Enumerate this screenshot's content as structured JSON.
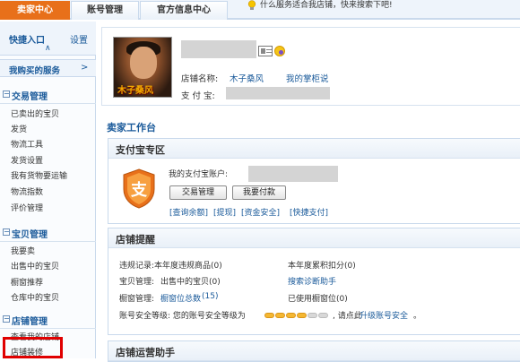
{
  "tabs": {
    "seller": "卖家中心",
    "account": "账号管理",
    "official": "官方信息中心"
  },
  "tip": "什么服务适合我店铺，快来搜索下吧!",
  "sidebar": {
    "quick_entry": "快捷入口",
    "settings": "设置",
    "bought_services": "我购买的服务",
    "sections": [
      {
        "title": "交易管理",
        "items": [
          "已卖出的宝贝",
          "发货",
          "物流工具",
          "发货设置",
          "我有货物要运输",
          "物流指数",
          "评价管理"
        ]
      },
      {
        "title": "宝贝管理",
        "items": [
          "我要卖",
          "出售中的宝贝",
          "橱窗推荐",
          "仓库中的宝贝"
        ]
      },
      {
        "title": "店铺管理",
        "items": [
          "查看我的店铺",
          "店铺装修"
        ]
      }
    ]
  },
  "profile": {
    "shop_name_label": "店铺名称:",
    "shop_name": "木子桑风",
    "my_counter": "我的掌柜说",
    "alipay_label": "支 付 宝:",
    "avatar_signature": "木子桑风"
  },
  "workbench_title": "卖家工作台",
  "alipay_zone": {
    "title": "支付宝专区",
    "account_label": "我的支付宝账户:",
    "btn_trade": "交易管理",
    "btn_pay": "我要付款",
    "links": [
      "[查询余额]",
      "[提现]",
      "[资金安全]",
      "[快捷支付]"
    ]
  },
  "reminder": {
    "title": "店铺提醒",
    "violation": "违规记录:本年度违规商品(0)",
    "yearly_points": "本年度累积扣分(0)",
    "items_label": "宝贝管理:",
    "items_value": "出售中的宝贝(0)",
    "diagnose": "搜索诊断助手",
    "window_label": "橱窗管理:",
    "window_total": "橱窗位总数",
    "window_total_count": "(15)",
    "window_used": "已使用橱窗位(0)",
    "security_label": "账号安全等级: 您的账号安全等级为",
    "security_suffix": ", 请点此",
    "security_link": "升级账号安全",
    "security_end": "。",
    "security_level": 4,
    "security_max": 6
  },
  "operations": {
    "title": "店铺运营助手"
  },
  "colors": {
    "accent": "#e8701a",
    "link": "#1a5a9a",
    "highlight_box": "#e00000"
  }
}
